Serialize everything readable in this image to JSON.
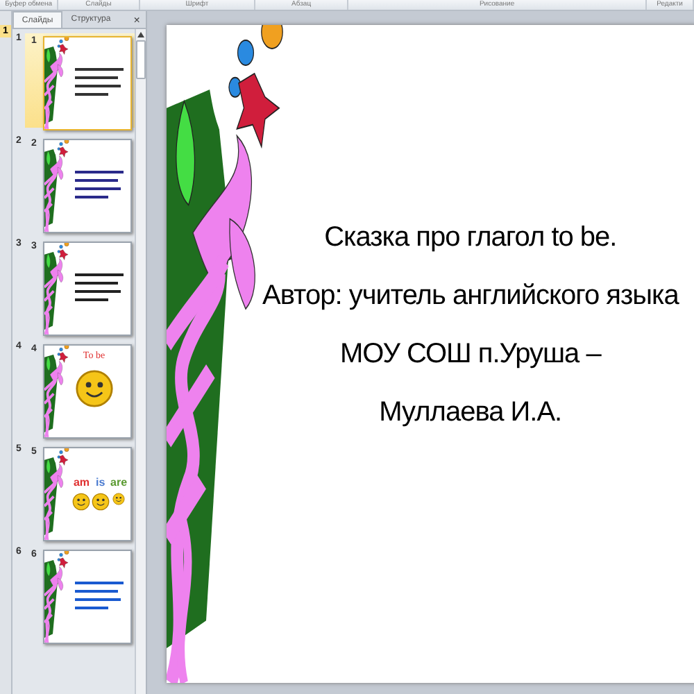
{
  "ribbon": {
    "groups": [
      "Буфер обмена",
      "Слайды",
      "Шрифт",
      "Абзац",
      "Рисование",
      "Редакти"
    ]
  },
  "left_strip": {
    "label": "1"
  },
  "panel": {
    "tabs": [
      {
        "label": "Слайды",
        "selected": true
      },
      {
        "label": "Структура",
        "selected": false
      }
    ],
    "close": "×",
    "slides": [
      {
        "number": "1",
        "number_inner": "1",
        "selected": true,
        "kind": "text",
        "color": "#333333"
      },
      {
        "number": "2",
        "number_inner": "2",
        "selected": false,
        "kind": "text",
        "color": "#2a2a8a"
      },
      {
        "number": "3",
        "number_inner": "3",
        "selected": false,
        "kind": "text",
        "color": "#222222"
      },
      {
        "number": "4",
        "number_inner": "4",
        "selected": false,
        "kind": "title-smiley",
        "words": [
          {
            "text": "To be",
            "color": "#e03030"
          }
        ]
      },
      {
        "number": "5",
        "number_inner": "5",
        "selected": false,
        "kind": "word-smileys",
        "words": [
          {
            "text": "am",
            "color": "#e03030"
          },
          {
            "text": "is",
            "color": "#4a7ad0"
          },
          {
            "text": "are",
            "color": "#5a9a30"
          }
        ]
      },
      {
        "number": "6",
        "number_inner": "6",
        "selected": false,
        "kind": "text",
        "color": "#1a5ad0"
      }
    ]
  },
  "slide": {
    "lines": [
      "Сказка про глагол to be.",
      "Автор: учитель английского языка",
      "МОУ СОШ п.Уруша –",
      "Муллаева И.А."
    ]
  }
}
